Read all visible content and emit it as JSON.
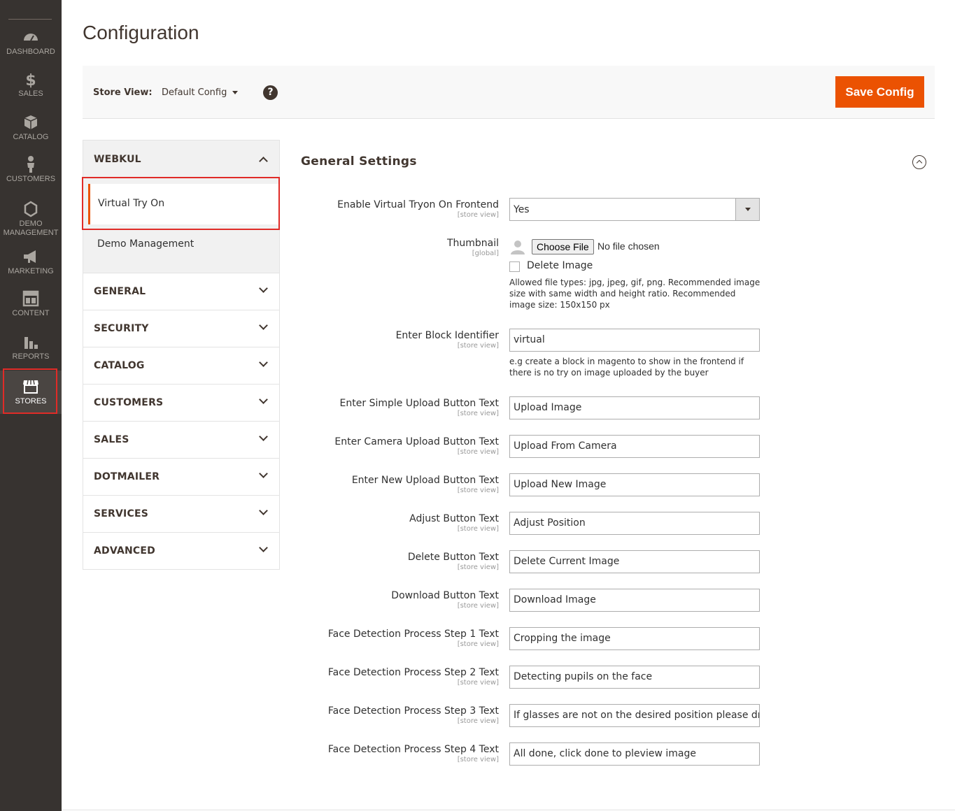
{
  "nav": {
    "items": [
      {
        "label": "DASHBOARD",
        "icon": "dashboard-icon"
      },
      {
        "label": "SALES",
        "icon": "dollar-icon"
      },
      {
        "label": "CATALOG",
        "icon": "box-icon"
      },
      {
        "label": "CUSTOMERS",
        "icon": "person-icon"
      },
      {
        "label_line1": "DEMO",
        "label_line2": "MANAGEMENT",
        "icon": "hexagon-icon"
      },
      {
        "label": "MARKETING",
        "icon": "megaphone-icon"
      },
      {
        "label": "CONTENT",
        "icon": "layout-icon"
      },
      {
        "label": "REPORTS",
        "icon": "bar-chart-icon"
      },
      {
        "label": "STORES",
        "icon": "store-icon",
        "active": true
      }
    ]
  },
  "page": {
    "title": "Configuration"
  },
  "actions": {
    "store_view_label": "Store View:",
    "store_view_value": "Default Config",
    "help": "?",
    "save_label": "Save Config"
  },
  "tabs": {
    "open_group": {
      "title": "WEBKUL",
      "items": [
        {
          "label": "Virtual Try On",
          "active": true
        },
        {
          "label": "Demo Management"
        }
      ]
    },
    "groups": [
      "GENERAL",
      "SECURITY",
      "CATALOG",
      "CUSTOMERS",
      "SALES",
      "DOTMAILER",
      "SERVICES",
      "ADVANCED"
    ]
  },
  "section": {
    "title": "General Settings"
  },
  "fields": {
    "enable": {
      "label": "Enable Virtual Tryon On Frontend",
      "scope": "[store view]",
      "value": "Yes"
    },
    "thumbnail": {
      "label": "Thumbnail",
      "scope": "[global]",
      "choose_file": "Choose File",
      "no_file": "No file chosen",
      "delete_label": "Delete Image",
      "note": "Allowed file types: jpg, jpeg, gif, png. Recommended image size with same width and height ratio. Recommended image size: 150x150 px"
    },
    "block_identifier": {
      "label": "Enter Block Identifier",
      "scope": "[store view]",
      "value": "virtual",
      "note": "e.g create a block in magento to show in the frontend if there is no try on image uploaded by the buyer"
    },
    "text_fields": [
      {
        "label": "Enter Simple Upload Button Text",
        "scope": "[store view]",
        "value": "Upload Image"
      },
      {
        "label": "Enter Camera Upload Button Text",
        "scope": "[store view]",
        "value": "Upload From Camera"
      },
      {
        "label": "Enter New Upload Button Text",
        "scope": "[store view]",
        "value": "Upload New Image"
      },
      {
        "label": "Adjust Button Text",
        "scope": "[store view]",
        "value": "Adjust Position"
      },
      {
        "label": "Delete Button Text",
        "scope": "[store view]",
        "value": "Delete Current Image"
      },
      {
        "label": "Download Button Text",
        "scope": "[store view]",
        "value": "Download Image"
      },
      {
        "label": "Face Detection Process Step 1 Text",
        "scope": "[store view]",
        "value": "Cropping the image"
      },
      {
        "label": "Face Detection Process Step 2 Text",
        "scope": "[store view]",
        "value": "Detecting pupils on the face"
      },
      {
        "label": "Face Detection Process Step 3 Text",
        "scope": "[store view]",
        "value": "If glasses are not on the desired position please drag i"
      },
      {
        "label": "Face Detection Process Step 4 Text",
        "scope": "[store view]",
        "value": "All done, click done to pleview image"
      }
    ]
  },
  "colors": {
    "accent": "#eb5202",
    "nav_bg": "#373330",
    "highlight": "#e02b27"
  }
}
